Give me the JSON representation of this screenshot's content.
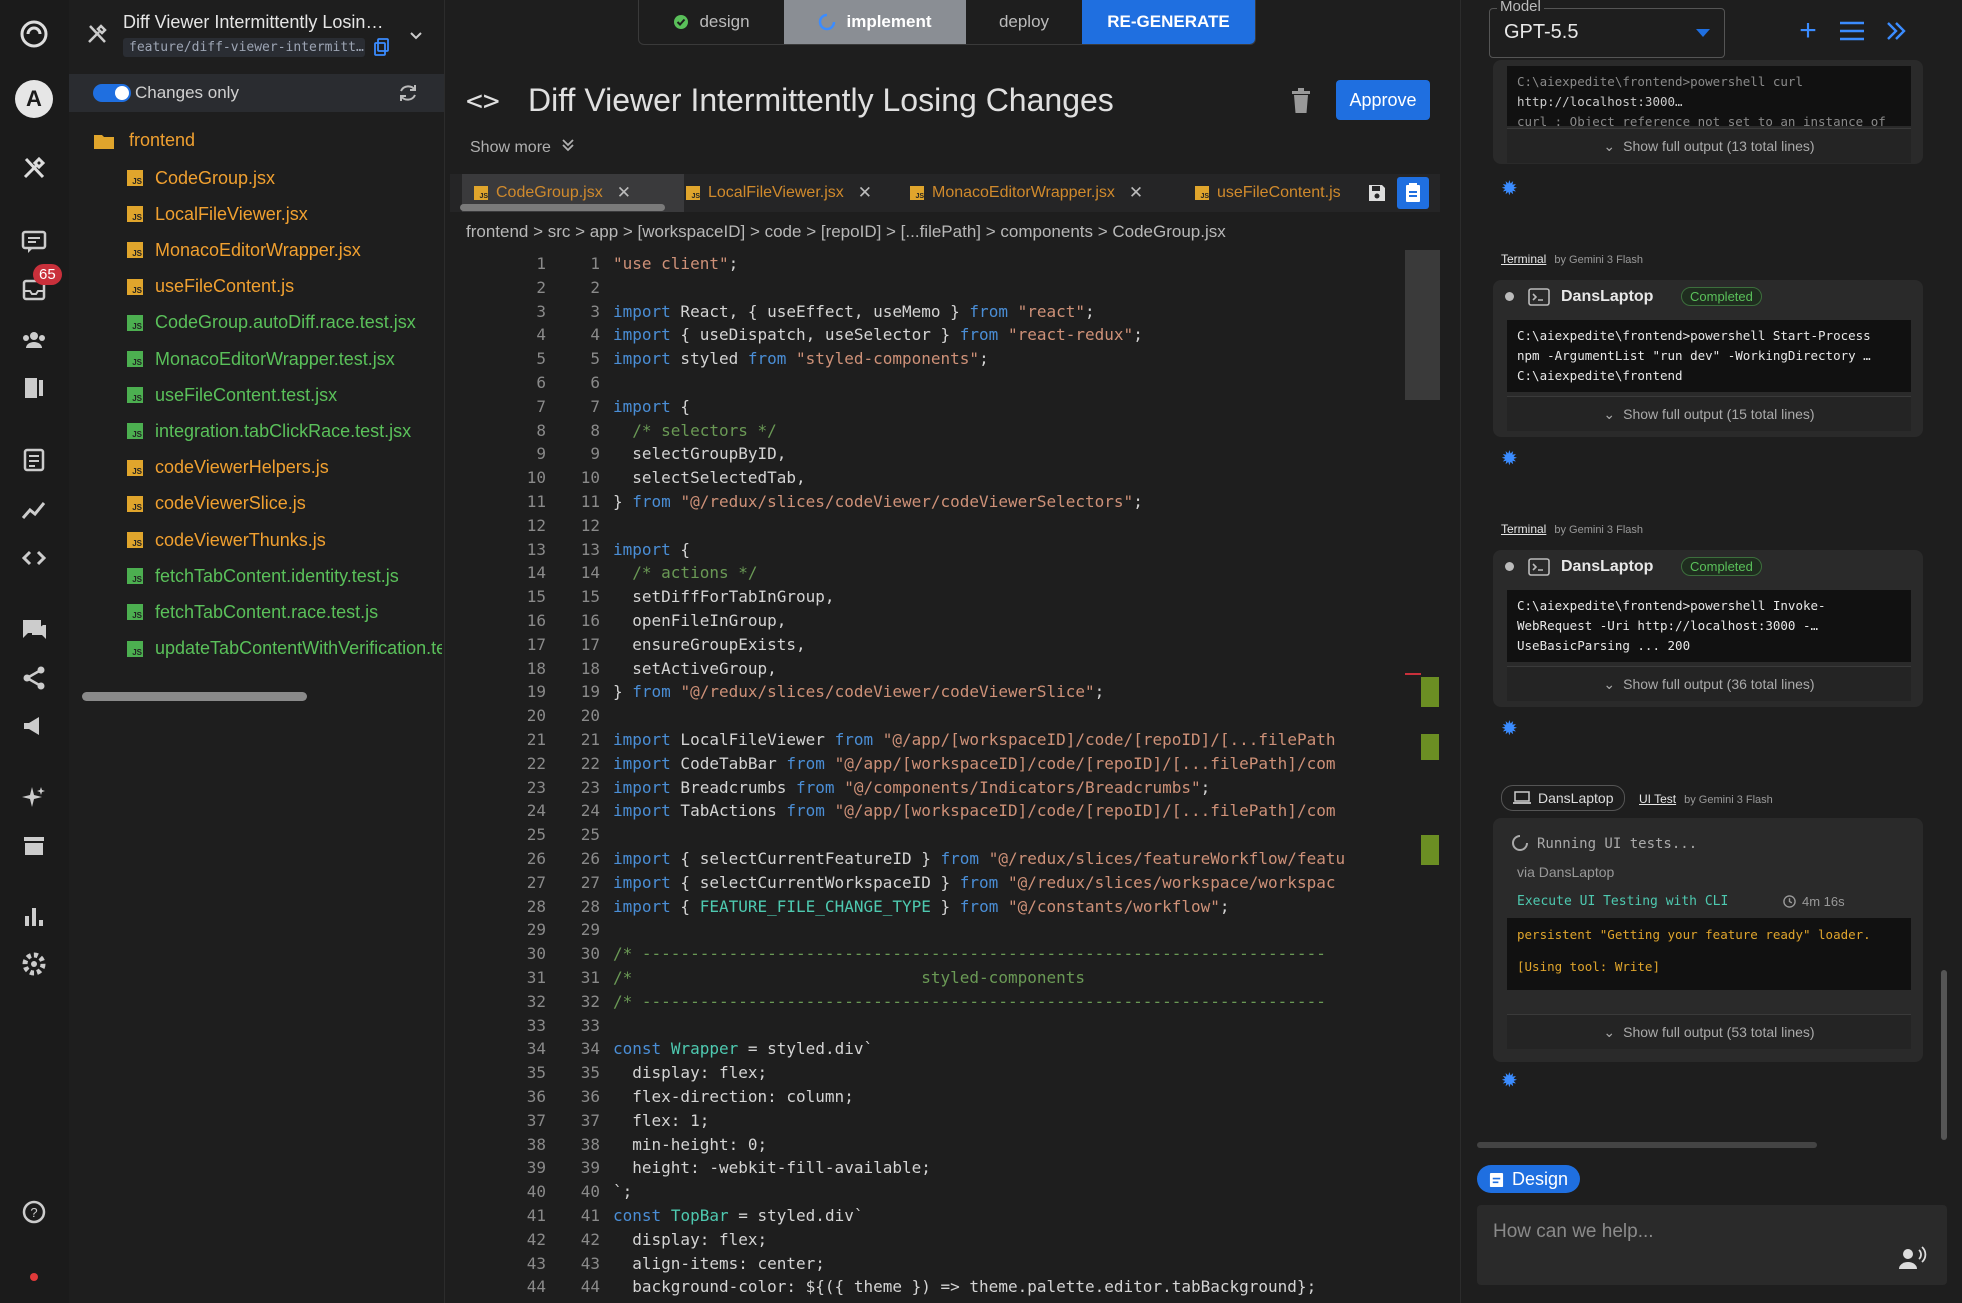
{
  "sidebar": {
    "avatar_letter": "A",
    "notification_count": "65"
  },
  "filepanel": {
    "title": "Diff Viewer Intermittently Losin…",
    "branch": "feature/diff-viewer-intermitt…",
    "changes_only_label": "Changes only",
    "folder": "frontend",
    "files": [
      {
        "name": "CodeGroup.jsx",
        "status": "modified"
      },
      {
        "name": "LocalFileViewer.jsx",
        "status": "modified"
      },
      {
        "name": "MonacoEditorWrapper.jsx",
        "status": "modified"
      },
      {
        "name": "useFileContent.js",
        "status": "modified"
      },
      {
        "name": "CodeGroup.autoDiff.race.test.jsx",
        "status": "added"
      },
      {
        "name": "MonacoEditorWrapper.test.jsx",
        "status": "added"
      },
      {
        "name": "useFileContent.test.jsx",
        "status": "added"
      },
      {
        "name": "integration.tabClickRace.test.jsx",
        "status": "added"
      },
      {
        "name": "codeViewerHelpers.js",
        "status": "modified"
      },
      {
        "name": "codeViewerSlice.js",
        "status": "modified"
      },
      {
        "name": "codeViewerThunks.js",
        "status": "modified"
      },
      {
        "name": "fetchTabContent.identity.test.js",
        "status": "added"
      },
      {
        "name": "fetchTabContent.race.test.js",
        "status": "added"
      },
      {
        "name": "updateTabContentWithVerification.test.js",
        "status": "added"
      }
    ]
  },
  "stages": {
    "design": "design",
    "implement": "implement",
    "deploy": "deploy",
    "regenerate": "RE-GENERATE"
  },
  "editor": {
    "title": "Diff Viewer Intermittently Losing Changes",
    "approve_label": "Approve",
    "show_more": "Show more",
    "tabs": [
      "CodeGroup.jsx",
      "LocalFileViewer.jsx",
      "MonacoEditorWrapper.jsx",
      "useFileContent.js"
    ],
    "breadcrumb": "frontend > src > app > [workspaceID] > code > [repoID] > [...filePath] > components > CodeGroup.jsx",
    "lines": [
      "\"use client\";",
      "",
      "import React, { useEffect, useMemo } from \"react\";",
      "import { useDispatch, useSelector } from \"react-redux\";",
      "import styled from \"styled-components\";",
      "",
      "import {",
      "  /* selectors */",
      "  selectGroupByID,",
      "  selectSelectedTab,",
      "} from \"@/redux/slices/codeViewer/codeViewerSelectors\";",
      "",
      "import {",
      "  /* actions */",
      "  setDiffForTabInGroup,",
      "  openFileInGroup,",
      "  ensureGroupExists,",
      "  setActiveGroup,",
      "} from \"@/redux/slices/codeViewer/codeViewerSlice\";",
      "",
      "import LocalFileViewer from \"@/app/[workspaceID]/code/[repoID]/[...filePath",
      "import CodeTabBar from \"@/app/[workspaceID]/code/[repoID]/[...filePath]/com",
      "import Breadcrumbs from \"@/components/Indicators/Breadcrumbs\";",
      "import TabActions from \"@/app/[workspaceID]/code/[repoID]/[...filePath]/com",
      "",
      "import { selectCurrentFeatureID } from \"@/redux/slices/featureWorkflow/featu",
      "import { selectCurrentWorkspaceID } from \"@/redux/slices/workspace/workspac",
      "import { FEATURE_FILE_CHANGE_TYPE } from \"@/constants/workflow\";",
      "",
      "/* -----------------------------------------------------------------------",
      "/*                              styled-components",
      "/* -----------------------------------------------------------------------",
      "",
      "const Wrapper = styled.div`",
      "  display: flex;",
      "  flex-direction: column;",
      "  flex: 1;",
      "  min-height: 0;",
      "  height: -webkit-fill-available;",
      "`;",
      "const TopBar = styled.div`",
      "  display: flex;",
      "  align-items: center;",
      "  background-color: ${({ theme }) => theme.palette.editor.tabBackground};"
    ]
  },
  "right": {
    "model_label": "Model",
    "model_value": "GPT-5.5",
    "card1": {
      "term_lines": [
        "C:\\aiexpedite\\frontend>powershell curl",
        "http://localhost:3000…",
        "curl : Object reference not set to an instance of"
      ],
      "full_output": "Show full output (13 total lines)"
    },
    "card2": {
      "tab": "Terminal",
      "by": "by Gemini 3 Flash",
      "machine": "DansLaptop",
      "status": "Completed",
      "term_lines": [
        "C:\\aiexpedite\\frontend>powershell Start-Process",
        "npm -ArgumentList \"run dev\" -WorkingDirectory …",
        "C:\\aiexpedite\\frontend"
      ],
      "full_output": "Show full output (15 total lines)"
    },
    "card3": {
      "tab": "Terminal",
      "by": "by Gemini 3 Flash",
      "machine": "DansLaptop",
      "status": "Completed",
      "term_lines": [
        "C:\\aiexpedite\\frontend>powershell Invoke-",
        "WebRequest -Uri http://localhost:3000 -…",
        "UseBasicParsing ... 200"
      ],
      "full_output": "Show full output (36 total lines)"
    },
    "card4": {
      "machine_chip": "DansLaptop",
      "tab": "UI Test",
      "by": "by Gemini 3 Flash",
      "running": "Running UI tests...",
      "via": "via DansLaptop",
      "task": "Execute UI Testing with CLI",
      "duration": "4m 16s",
      "log1": "persistent \"Getting your feature ready\" loader.",
      "log2": "[Using tool: Write]",
      "full_output": "Show full output (53 total lines)"
    },
    "design_chip": "Design",
    "chat_placeholder": "How can we help..."
  }
}
